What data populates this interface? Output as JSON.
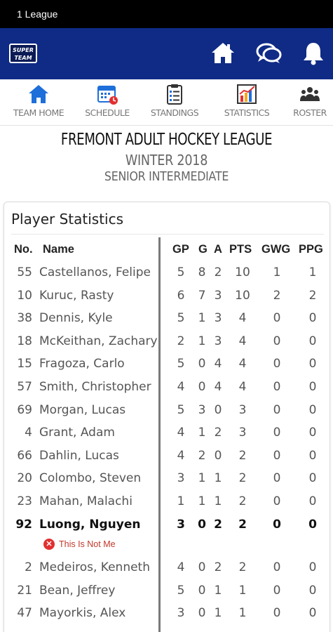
{
  "status_bar": {
    "text": "1 League"
  },
  "header": {
    "logo_text": "SUPER TEAM"
  },
  "tabs": [
    {
      "label": "Team Home",
      "icon": "home-icon"
    },
    {
      "label": "Schedule",
      "icon": "calendar-icon"
    },
    {
      "label": "Standings",
      "icon": "clipboard-icon"
    },
    {
      "label": "Statistics",
      "icon": "chart-icon"
    },
    {
      "label": "Roster",
      "icon": "people-icon"
    }
  ],
  "league": {
    "title": "FREMONT ADULT HOCKEY LEAGUE",
    "season": "WINTER 2018",
    "division": "SENIOR INTERMEDIATE"
  },
  "stats": {
    "title": "Player Statistics",
    "columns": {
      "no": "No.",
      "name": "Name",
      "gp": "GP",
      "g": "G",
      "a": "A",
      "pts": "PTS",
      "gwg": "GWG",
      "ppg": "PPG"
    },
    "rows": [
      {
        "no": "55",
        "name": "Castellanos, Felipe",
        "gp": "5",
        "g": "8",
        "a": "2",
        "pts": "10",
        "gwg": "1",
        "ppg": "1"
      },
      {
        "no": "10",
        "name": "Kuruc, Rasty",
        "gp": "6",
        "g": "7",
        "a": "3",
        "pts": "10",
        "gwg": "2",
        "ppg": "2"
      },
      {
        "no": "38",
        "name": "Dennis, Kyle",
        "gp": "5",
        "g": "1",
        "a": "3",
        "pts": "4",
        "gwg": "0",
        "ppg": "0"
      },
      {
        "no": "18",
        "name": "McKeithan, Zachary",
        "gp": "2",
        "g": "1",
        "a": "3",
        "pts": "4",
        "gwg": "0",
        "ppg": "0"
      },
      {
        "no": "15",
        "name": "Fragoza, Carlo",
        "gp": "5",
        "g": "0",
        "a": "4",
        "pts": "4",
        "gwg": "0",
        "ppg": "0"
      },
      {
        "no": "57",
        "name": "Smith, Christopher",
        "gp": "4",
        "g": "0",
        "a": "4",
        "pts": "4",
        "gwg": "0",
        "ppg": "0"
      },
      {
        "no": "69",
        "name": "Morgan, Lucas",
        "gp": "5",
        "g": "3",
        "a": "0",
        "pts": "3",
        "gwg": "0",
        "ppg": "0"
      },
      {
        "no": "4",
        "name": "Grant, Adam",
        "gp": "4",
        "g": "1",
        "a": "2",
        "pts": "3",
        "gwg": "0",
        "ppg": "0"
      },
      {
        "no": "66",
        "name": "Dahlin, Lucas",
        "gp": "4",
        "g": "2",
        "a": "0",
        "pts": "2",
        "gwg": "0",
        "ppg": "0"
      },
      {
        "no": "20",
        "name": "Colombo, Steven",
        "gp": "3",
        "g": "1",
        "a": "1",
        "pts": "2",
        "gwg": "0",
        "ppg": "0"
      },
      {
        "no": "23",
        "name": "Mahan, Malachi",
        "gp": "1",
        "g": "1",
        "a": "1",
        "pts": "2",
        "gwg": "0",
        "ppg": "0"
      },
      {
        "no": "92",
        "name": "Luong, Nguyen",
        "gp": "3",
        "g": "0",
        "a": "2",
        "pts": "2",
        "gwg": "0",
        "ppg": "0",
        "highlight": true,
        "note": "This Is Not Me"
      },
      {
        "no": "2",
        "name": "Medeiros, Kenneth",
        "gp": "4",
        "g": "0",
        "a": "2",
        "pts": "2",
        "gwg": "0",
        "ppg": "0"
      },
      {
        "no": "21",
        "name": "Bean, Jeffrey",
        "gp": "5",
        "g": "0",
        "a": "1",
        "pts": "1",
        "gwg": "0",
        "ppg": "0"
      },
      {
        "no": "47",
        "name": "Mayorkis, Alex",
        "gp": "3",
        "g": "0",
        "a": "1",
        "pts": "1",
        "gwg": "0",
        "ppg": "0"
      }
    ]
  },
  "colors": {
    "header_bg": "#0f2b86",
    "accent_blue": "#1e6fd9",
    "warn_red": "#e23030"
  }
}
